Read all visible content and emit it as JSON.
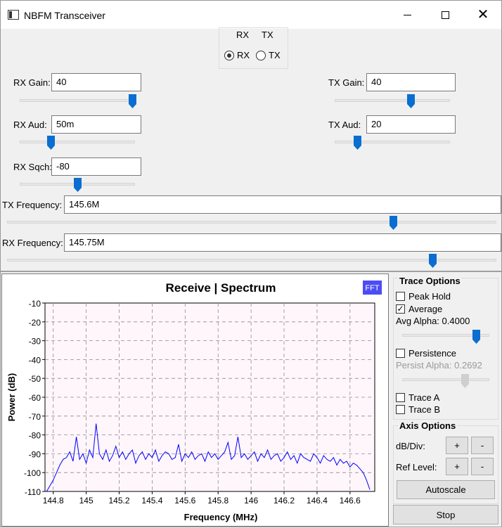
{
  "window": {
    "title": "NBFM Transceiver"
  },
  "mode": {
    "header_rx": "RX",
    "header_tx": "TX",
    "option_rx": "RX",
    "option_tx": "TX",
    "selected": "RX"
  },
  "rx_gain": {
    "label": "RX Gain:",
    "value": "40",
    "slider_fraction": 0.98
  },
  "rx_aud": {
    "label": "RX Aud:",
    "value": "50m",
    "slider_fraction": 0.27
  },
  "rx_sqch": {
    "label": "RX Sqch:",
    "value": "-80",
    "slider_fraction": 0.5
  },
  "tx_gain": {
    "label": "TX Gain:",
    "value": "40",
    "slider_fraction": 0.66
  },
  "tx_aud": {
    "label": "TX Aud:",
    "value": "20",
    "slider_fraction": 0.2
  },
  "tx_freq": {
    "label": "TX Frequency:",
    "value": "145.6M",
    "slider_fraction": 0.79
  },
  "rx_freq": {
    "label": "RX Frequency:",
    "value": "145.75M",
    "slider_fraction": 0.87
  },
  "plot": {
    "title": "Receive  |  Spectrum",
    "badge": "FFT",
    "xlabel": "Frequency (MHz)",
    "ylabel": "Power (dB)",
    "accent": "#3c3cf0"
  },
  "trace_options": {
    "title": "Trace Options",
    "peak_hold": {
      "label": "Peak Hold",
      "checked": false
    },
    "average": {
      "label": "Average",
      "checked": true
    },
    "avg_alpha": {
      "label": "Avg Alpha: 0.4000",
      "slider_fraction": 0.85
    },
    "persistence": {
      "label": "Persistence",
      "checked": false
    },
    "persist_alpha": {
      "label": "Persist Alpha: 0.2692",
      "slider_fraction": 0.72
    },
    "trace_a": {
      "label": "Trace A",
      "checked": false
    },
    "trace_b": {
      "label": "Trace B",
      "checked": false
    }
  },
  "axis_options": {
    "title": "Axis Options",
    "db_div": "dB/Div:",
    "ref_level": "Ref Level:",
    "plus": "+",
    "minus": "-",
    "autoscale": "Autoscale"
  },
  "stop_label": "Stop",
  "chart_data": {
    "type": "line",
    "title": "Receive  |  Spectrum",
    "xlabel": "Frequency (MHz)",
    "ylabel": "Power (dB)",
    "xlim": [
      144.75,
      146.75
    ],
    "ylim": [
      -110,
      -10
    ],
    "xticks": [
      "144.8",
      "145",
      "145.2",
      "145.4",
      "145.6",
      "145.8",
      "146",
      "146.2",
      "146.4",
      "146.6"
    ],
    "xtick_values": [
      144.8,
      145.0,
      145.2,
      145.4,
      145.6,
      145.8,
      146.0,
      146.2,
      146.4,
      146.6
    ],
    "yticks": [
      "-10",
      "-20",
      "-30",
      "-40",
      "-50",
      "-60",
      "-70",
      "-80",
      "-90",
      "-100",
      "-110"
    ],
    "ytick_values": [
      -10,
      -20,
      -30,
      -40,
      -50,
      -60,
      -70,
      -80,
      -90,
      -100,
      -110
    ],
    "grid": true,
    "series": [
      {
        "color": "#0000ff",
        "x": [
          144.76,
          144.78,
          144.8,
          144.82,
          144.84,
          144.86,
          144.88,
          144.9,
          144.92,
          144.94,
          144.96,
          144.98,
          145.0,
          145.02,
          145.04,
          145.06,
          145.08,
          145.1,
          145.12,
          145.14,
          145.16,
          145.18,
          145.2,
          145.22,
          145.24,
          145.26,
          145.28,
          145.3,
          145.32,
          145.34,
          145.36,
          145.38,
          145.4,
          145.42,
          145.44,
          145.46,
          145.48,
          145.5,
          145.52,
          145.54,
          145.56,
          145.58,
          145.6,
          145.62,
          145.64,
          145.66,
          145.68,
          145.7,
          145.72,
          145.74,
          145.76,
          145.78,
          145.8,
          145.82,
          145.84,
          145.86,
          145.88,
          145.9,
          145.92,
          145.94,
          145.96,
          145.98,
          146.0,
          146.02,
          146.04,
          146.06,
          146.08,
          146.1,
          146.12,
          146.14,
          146.16,
          146.18,
          146.2,
          146.22,
          146.24,
          146.26,
          146.28,
          146.3,
          146.32,
          146.34,
          146.36,
          146.38,
          146.4,
          146.42,
          146.44,
          146.46,
          146.48,
          146.5,
          146.52,
          146.54,
          146.56,
          146.58,
          146.6,
          146.62,
          146.64,
          146.66,
          146.68,
          146.7,
          146.72
        ],
        "y": [
          -110,
          -107,
          -104,
          -100,
          -96,
          -93,
          -92,
          -89,
          -94,
          -81,
          -93,
          -90,
          -95,
          -88,
          -92,
          -74,
          -90,
          -93,
          -88,
          -94,
          -91,
          -86,
          -92,
          -89,
          -93,
          -90,
          -88,
          -95,
          -91,
          -89,
          -93,
          -90,
          -92,
          -88,
          -94,
          -91,
          -89,
          -90,
          -93,
          -92,
          -85,
          -94,
          -90,
          -92,
          -89,
          -93,
          -91,
          -90,
          -94,
          -89,
          -92,
          -90,
          -93,
          -91,
          -89,
          -84,
          -93,
          -91,
          -81,
          -92,
          -90,
          -93,
          -91,
          -89,
          -94,
          -90,
          -92,
          -88,
          -93,
          -91,
          -90,
          -94,
          -92,
          -89,
          -93,
          -91,
          -95,
          -90,
          -92,
          -93,
          -94,
          -90,
          -92,
          -95,
          -91,
          -93,
          -94,
          -92,
          -96,
          -93,
          -95,
          -94,
          -97,
          -95,
          -96,
          -98,
          -100,
          -104,
          -109
        ]
      }
    ]
  }
}
